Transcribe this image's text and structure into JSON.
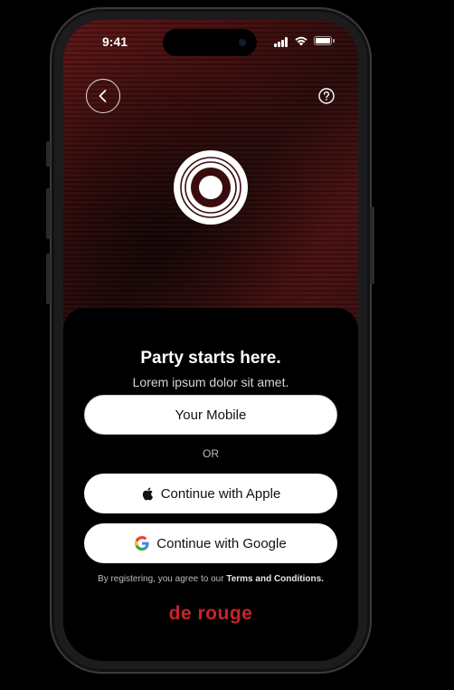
{
  "status_bar": {
    "time": "9:41",
    "icons": [
      "signal-icon",
      "wifi-icon",
      "battery-icon"
    ]
  },
  "hero": {
    "back_icon": "chevron-left-icon",
    "help_icon": "question-circle-icon",
    "logo_icon": "concentric-circles-logo",
    "accent_color": "#5a1414"
  },
  "auth": {
    "headline": "Party starts here.",
    "subheadline": "Lorem ipsum dolor sit amet.",
    "mobile_button": "Your Mobile",
    "divider_text": "OR",
    "apple_button": "Continue with Apple",
    "google_button": "Continue with Google",
    "legal_prefix": "By registering, you agree to our",
    "legal_link": "Terms and Conditions."
  },
  "brand": {
    "name": "de rouge",
    "color": "#c8232c"
  }
}
